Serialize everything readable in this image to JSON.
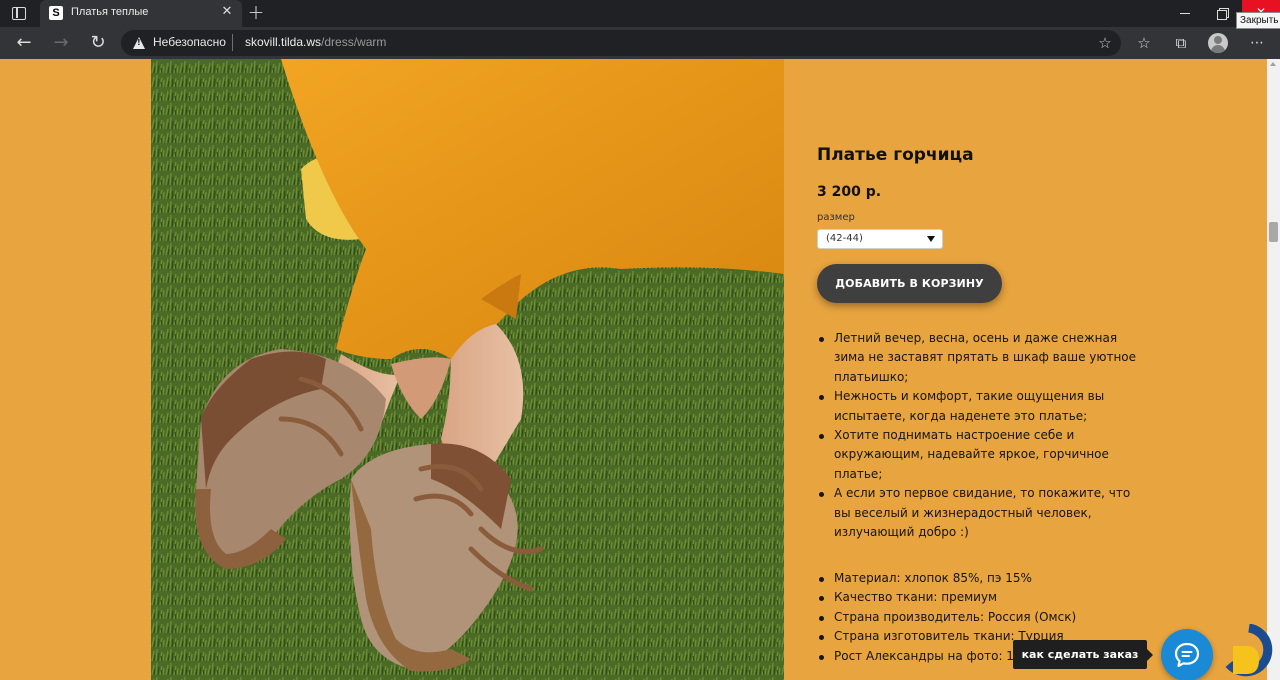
{
  "browser": {
    "tab_title": "Платья теплые",
    "tab_favicon_letter": "S",
    "close_tooltip": "Закрыть",
    "security_label": "Небезопасно",
    "url_host": "skovill.tilda.ws",
    "url_path": "/dress/warm"
  },
  "colors": {
    "page_background": "#e8a43f",
    "cart_button": "#3f3f3f",
    "chat_button": "#1a8ad6"
  },
  "product": {
    "title": "Платье горчица",
    "price": "3 200 р.",
    "size_label": "размер",
    "size_selected": "(42-44)",
    "cart_button": "ДОБАВИТЬ В КОРЗИНУ",
    "description": [
      "Летний вечер, весна, осень и даже снежная зима не заставят прятать в шкаф ваше уютное платьишко;",
      "Нежность и комфорт, такие ощущения вы испытаете, когда наденете это платье;",
      "Хотите поднимать настроение себе и окружающим, надевайте яркое, горчичное платье;",
      "А если это первое свидание, то покажите, что вы веселый и жизнерадостный человек, излучающий добро :)"
    ],
    "specs": [
      "Материал: хлопок 85%, пэ 15%",
      "Качество ткани: премиум",
      "Страна производитель: Россия (Омск)",
      "Страна изготовитель ткани: Турция",
      "Рост Александры на фото: 167 см"
    ]
  },
  "chat": {
    "tooltip": "как сделать заказ"
  },
  "icons": {
    "tab_actions": "tab-actions-icon",
    "back": "back-arrow-icon",
    "forward": "forward-arrow-icon",
    "reload": "reload-icon",
    "warning": "warning-icon",
    "favorites_add": "star-plus-icon",
    "favorites": "favorites-icon",
    "collections": "collections-icon",
    "profile": "profile-icon",
    "menu": "more-menu-icon",
    "chat": "chat-bubble-icon"
  }
}
